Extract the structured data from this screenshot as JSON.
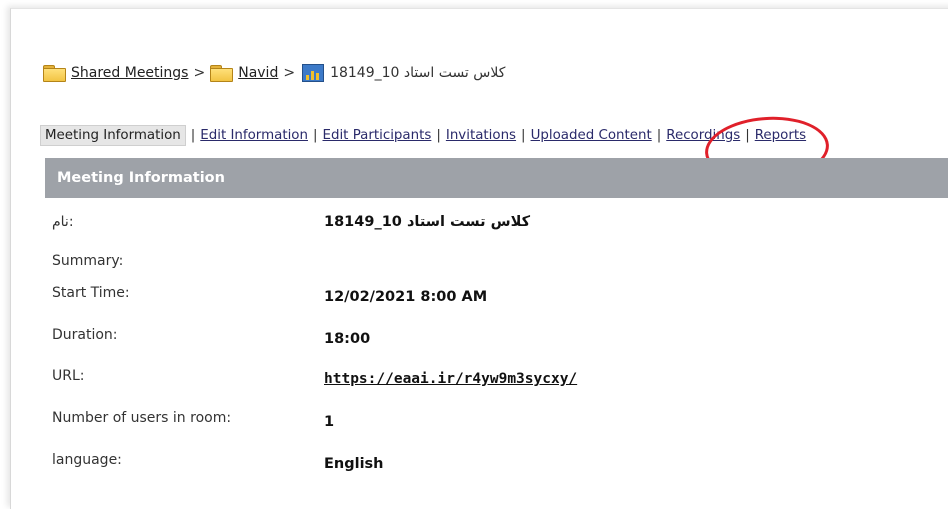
{
  "breadcrumb": {
    "root": "Shared Meetings",
    "sep1": ">",
    "folder": "Navid",
    "sep2": ">",
    "current": "کلاس تست استاد 10_18149"
  },
  "tabs": {
    "meeting_information": "Meeting Information",
    "edit_information": "Edit Information",
    "edit_participants": "Edit Participants",
    "invitations": "Invitations",
    "uploaded_content": "Uploaded Content",
    "recordings": "Recordings",
    "reports": "Reports",
    "separator": "|"
  },
  "section": {
    "title": "Meeting Information"
  },
  "fields": {
    "name_label": ":نام",
    "name_value": "کلاس تست استاد 10_18149",
    "summary_label": "Summary:",
    "start_label": "Start Time:",
    "start_value": "12/02/2021 8:00 AM",
    "duration_label": "Duration:",
    "duration_value": "18:00",
    "url_label": "URL:",
    "url_value": "https://eaai.ir/r4yw9m3sycxy/",
    "users_label": "Number of users in room:",
    "users_value": "1",
    "language_label": "language:",
    "language_value": "English"
  },
  "colors": {
    "header_bg": "#9ea2a8",
    "annotation": "#e0202a"
  },
  "icons": {
    "folder": "folder-icon",
    "meeting": "meeting-icon"
  }
}
